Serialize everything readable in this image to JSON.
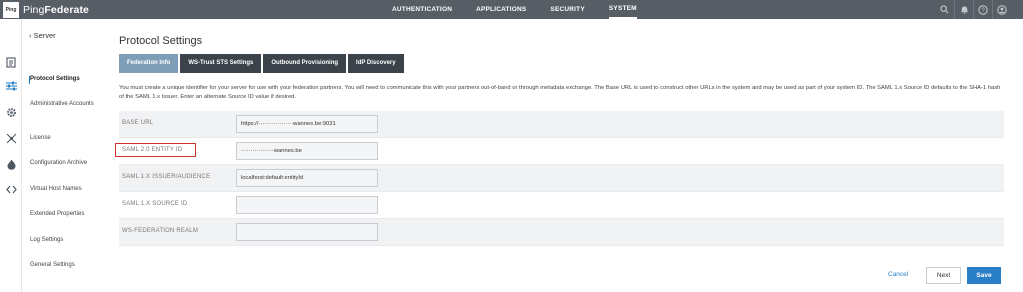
{
  "app": {
    "logo_text": "Ping",
    "brand_prefix": "Ping",
    "brand_suffix": "Federate"
  },
  "topnav": {
    "items": [
      {
        "label": "AUTHENTICATION"
      },
      {
        "label": "APPLICATIONS"
      },
      {
        "label": "SECURITY"
      },
      {
        "label": "SYSTEM",
        "active": true
      }
    ],
    "icons": [
      "search-icon",
      "bell-icon",
      "help-icon",
      "user-icon"
    ]
  },
  "rail": {
    "icons": [
      "document-icon",
      "sliders-icon",
      "gear-icon",
      "network-icon",
      "fire-icon",
      "code-icon"
    ]
  },
  "sidebar": {
    "back_label": "Server",
    "items": [
      {
        "label": "Protocol Settings",
        "active": true
      },
      {
        "label": "Administrative Accounts"
      },
      {
        "label": "License"
      },
      {
        "label": "Configuration Archive"
      },
      {
        "label": "Virtual Host Names"
      },
      {
        "label": "Extended Properties"
      },
      {
        "label": "Log Settings"
      },
      {
        "label": "General Settings"
      }
    ]
  },
  "main": {
    "title": "Protocol Settings",
    "tabs": [
      {
        "label": "Federation Info",
        "active": true
      },
      {
        "label": "WS-Trust STS Settings"
      },
      {
        "label": "Outbound Provisioning"
      },
      {
        "label": "IdP Discovery"
      }
    ],
    "description": "You must create a unique identifier for your server for use with your federation partners. You will need to communicate this with your partners out-of-band or through metadata exchange. The Base URL is used to construct other URLs in the system and may be used as part of your system ID. The SAML 1.x Source ID defaults to the SHA-1 hash of the SAML 1.x Issuer. Enter an alternate Source ID value if desired.",
    "fields": [
      {
        "label": "BASE URL",
        "value": "https://··················wannes.be:9031"
      },
      {
        "label": "SAML 2.0 ENTITY ID",
        "value": "·················wannes.be",
        "highlighted": true
      },
      {
        "label": "SAML 1.X ISSUER/AUDIENCE",
        "value": "localhost:default:entityId"
      },
      {
        "label": "SAML 1.X SOURCE ID",
        "value": ""
      },
      {
        "label": "WS-FEDERATION REALM",
        "value": ""
      }
    ]
  },
  "footer": {
    "cancel_label": "Cancel",
    "next_label": "Next",
    "save_label": "Save"
  },
  "colors": {
    "topbar": "#585e66",
    "accent": "#2980c6",
    "tab_dark": "#3c434b",
    "tab_active": "#7e9db7",
    "highlight": "#d32f2f"
  }
}
